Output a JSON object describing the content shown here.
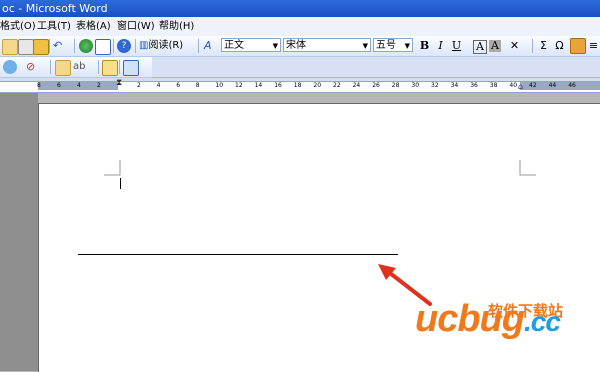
{
  "window": {
    "title": "oc - Microsoft Word"
  },
  "menu": [
    "格式(O)",
    "工具(T)",
    "表格(A)",
    "窗口(W)",
    "帮助(H)"
  ],
  "toolbar": {
    "read_label": "阅读(R)",
    "style_value": "正文",
    "font_value": "宋体",
    "size_value": "五号",
    "bold_label": "B",
    "italic_label": "I",
    "underline_label": "U",
    "sum_symbol": "Σ",
    "omega_symbol": "Ω"
  },
  "ruler": {
    "ticks": [
      "8",
      "6",
      "4",
      "2",
      "2",
      "4",
      "6",
      "8",
      "10",
      "12",
      "14",
      "16",
      "18",
      "20",
      "22",
      "24",
      "26",
      "28",
      "30",
      "32",
      "34",
      "36",
      "38",
      "40",
      "42",
      "44",
      "46"
    ]
  },
  "watermark": {
    "logo_text": "ucbug",
    "logo_suffix": ".cc",
    "cn_text": "软件下载站"
  },
  "colors": {
    "title_bar": "#1a4fc4",
    "arrow": "#e0301e",
    "watermark_orange": "#f07a1b",
    "watermark_blue": "#1c9fe0"
  },
  "icons": [
    "word-app-icon",
    "save-icon",
    "print-icon",
    "undo-icon",
    "hyperlink-icon",
    "table-icon",
    "help-icon",
    "read-icon",
    "style-icon",
    "bold-icon",
    "italic-icon",
    "underline-icon",
    "highlight-icon",
    "font-color-icon",
    "sum-icon",
    "omega-icon",
    "border-icon"
  ]
}
